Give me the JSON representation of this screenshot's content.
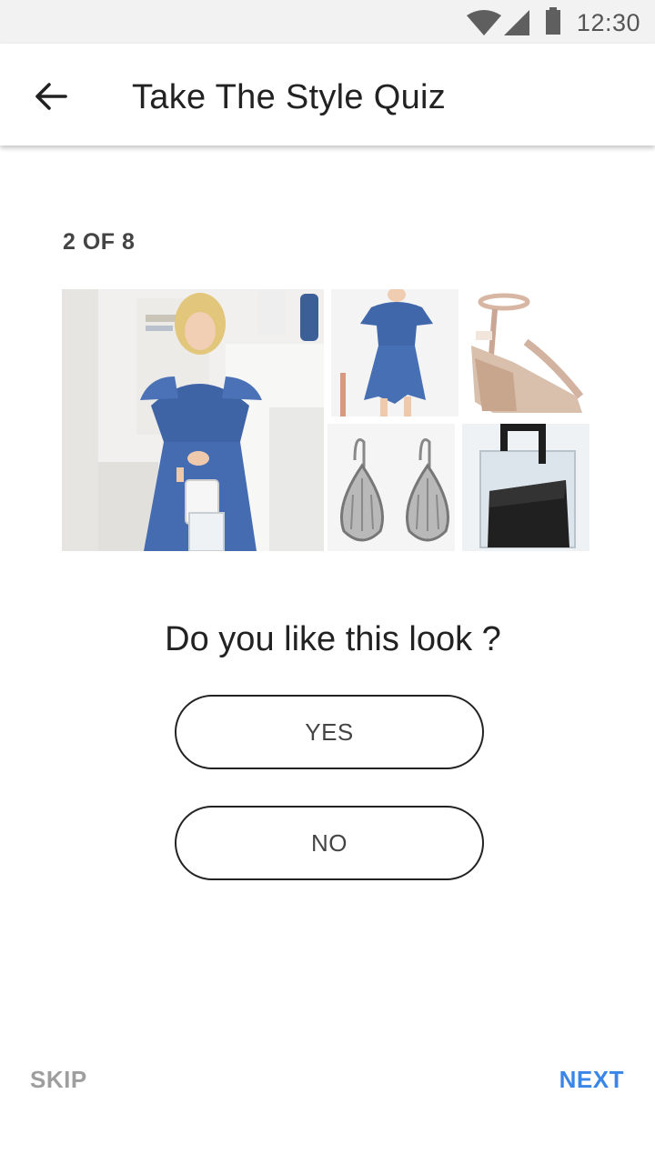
{
  "status_bar": {
    "time": "12:30",
    "icons": [
      "wifi-icon",
      "signal-icon",
      "battery-icon"
    ]
  },
  "app_bar": {
    "title": "Take The Style Quiz",
    "back_icon": "arrow-back-icon"
  },
  "quiz": {
    "step_label": "2 OF 8",
    "step_current": 2,
    "step_total": 8,
    "question": "Do you like this look ?",
    "answers": {
      "yes_label": "YES",
      "no_label": "NO"
    },
    "look_images": [
      "look-photo-model-in-denim-dress",
      "denim-ruffle-dress-photo",
      "rose-gold-wedge-sandal-photo",
      "silver-teardrop-earrings-photo",
      "clear-tote-bag-photo"
    ]
  },
  "footer": {
    "skip_label": "SKIP",
    "next_label": "NEXT"
  },
  "colors": {
    "accent": "#3a86e8",
    "muted": "#9e9e9e",
    "status_bar_bg": "#f2f2f2"
  }
}
